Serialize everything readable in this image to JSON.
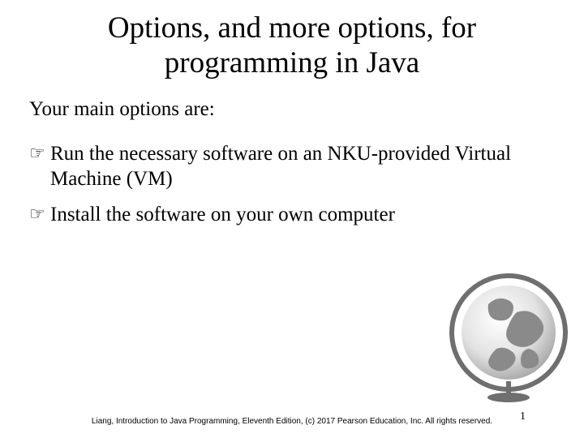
{
  "title": "Options, and more options, for programming in Java",
  "intro": "Your main options are:",
  "bullets": [
    {
      "icon": "☞",
      "text": "Run the necessary software on an NKU-provided Virtual Machine (VM)"
    },
    {
      "icon": "☞",
      "text": "Install the software on your own computer"
    }
  ],
  "footer": "Liang, Introduction to Java Programming, Eleventh Edition, (c) 2017 Pearson Education, Inc. All rights reserved.",
  "page_number": "1"
}
